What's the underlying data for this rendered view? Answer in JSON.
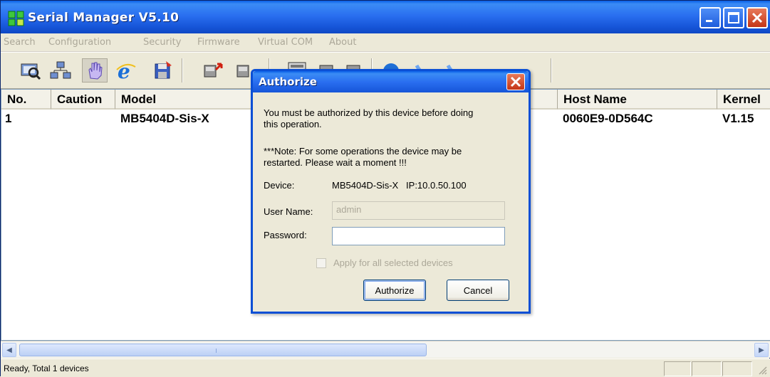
{
  "window": {
    "title": "Serial Manager V5.10",
    "icons": [
      "app-logo-icon",
      "minimize-icon",
      "maximize-icon",
      "close-icon"
    ]
  },
  "menu": {
    "items": [
      {
        "label": "Search"
      },
      {
        "label": "Configuration"
      },
      {
        "label": "Security"
      },
      {
        "label": "Firmware"
      },
      {
        "label": "Virtual COM"
      },
      {
        "label": "About"
      }
    ]
  },
  "toolbar": {
    "tools": [
      {
        "icon": "search-device-icon"
      },
      {
        "icon": "network-icon"
      },
      {
        "icon": "hand-icon"
      },
      {
        "icon": "browser-icon"
      },
      {
        "icon": "save-icon"
      },
      {
        "icon": "download-icon"
      },
      {
        "icon": "upload-icon"
      },
      {
        "icon": "config-icon"
      },
      {
        "icon": "device-icon"
      },
      {
        "icon": "device-icon"
      },
      {
        "icon": "globe-icon"
      },
      {
        "icon": "phone-icon"
      },
      {
        "icon": "phone-icon"
      }
    ]
  },
  "table": {
    "columns": [
      "No.",
      "Caution",
      "Model",
      "Host Name",
      "Kernel"
    ],
    "rows": [
      {
        "no": "1",
        "caution": "",
        "model": "MB5404D-Sis-X",
        "host_name": "0060E9-0D564C",
        "kernel": "V1.15"
      }
    ]
  },
  "status": {
    "text": "Ready, Total 1 devices"
  },
  "dialog": {
    "title": "Authorize",
    "message_line1": "You must be authorized by this device before doing",
    "message_line2": "this operation.",
    "note_line1": "***Note: For some operations the device may be",
    "note_line2": "restarted. Please wait a moment !!!",
    "device_label": "Device:",
    "device_value": "MB5404D-Sis-X   IP:10.0.50.100",
    "username_label": "User Name:",
    "username_value": "admin",
    "password_label": "Password:",
    "password_value": "",
    "apply_all_label": "Apply for all selected devices",
    "apply_all_checked": false,
    "authorize_button": "Authorize",
    "cancel_button": "Cancel"
  }
}
